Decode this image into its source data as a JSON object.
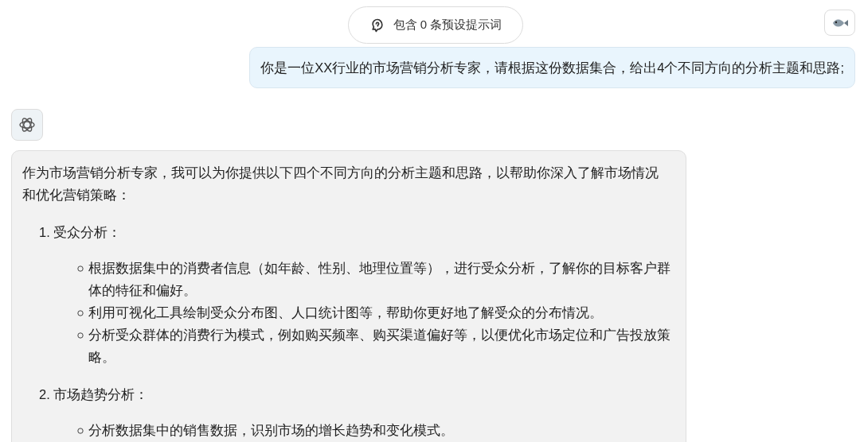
{
  "prompt_chip": {
    "label": "包含 0 条预设提示词"
  },
  "user_message": {
    "text": "你是一位XX行业的市场营销分析专家，请根据这份数据集合，给出4个不同方向的分析主题和思路;"
  },
  "assistant_message": {
    "intro": "作为市场营销分析专家，我可以为你提供以下四个不同方向的分析主题和思路，以帮助你深入了解市场情况和优化营销策略：",
    "sections": [
      {
        "marker": "1.",
        "title": "受众分析：",
        "points": [
          "根据数据集中的消费者信息（如年龄、性别、地理位置等），进行受众分析，了解你的目标客户群体的特征和偏好。",
          "利用可视化工具绘制受众分布图、人口统计图等，帮助你更好地了解受众的分布情况。",
          "分析受众群体的消费行为模式，例如购买频率、购买渠道偏好等，以便优化市场定位和广告投放策略。"
        ]
      },
      {
        "marker": "2.",
        "title": "市场趋势分析：",
        "points": [
          "分析数据集中的销售数据，识别市场的增长趋势和变化模式。"
        ]
      }
    ]
  }
}
